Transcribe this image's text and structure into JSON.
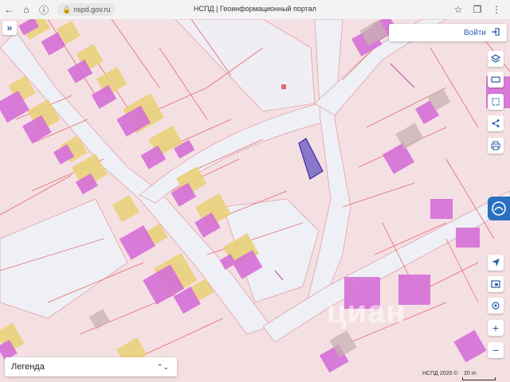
{
  "browser": {
    "url": "nspd.gov.ru",
    "tab_title": "НСПД | Геоинформационный портал"
  },
  "header": {
    "login_label": "Войти"
  },
  "toolbar": {
    "tools": [
      "layers-icon",
      "ruler-icon",
      "select-area-icon",
      "share-icon",
      "print-icon"
    ],
    "nav_tools": [
      "locate-icon",
      "screen-icon",
      "geolocation-icon",
      "zoom-in-icon",
      "zoom-out-icon"
    ]
  },
  "legend": {
    "label": "Легенда"
  },
  "footer": {
    "attribution": "НСПД 2020 ©",
    "scale_label": "20 m"
  },
  "watermark": {
    "text": "циан"
  },
  "colors": {
    "parcel_fill": "#f4e0e3",
    "parcel_line": "#e36a6a",
    "road": "#eef0f6",
    "building_yellow": "#e9d27a",
    "building_magenta": "#d56fd7",
    "highlight_parcel": "#8a78c8",
    "accent": "#2a5caa"
  }
}
